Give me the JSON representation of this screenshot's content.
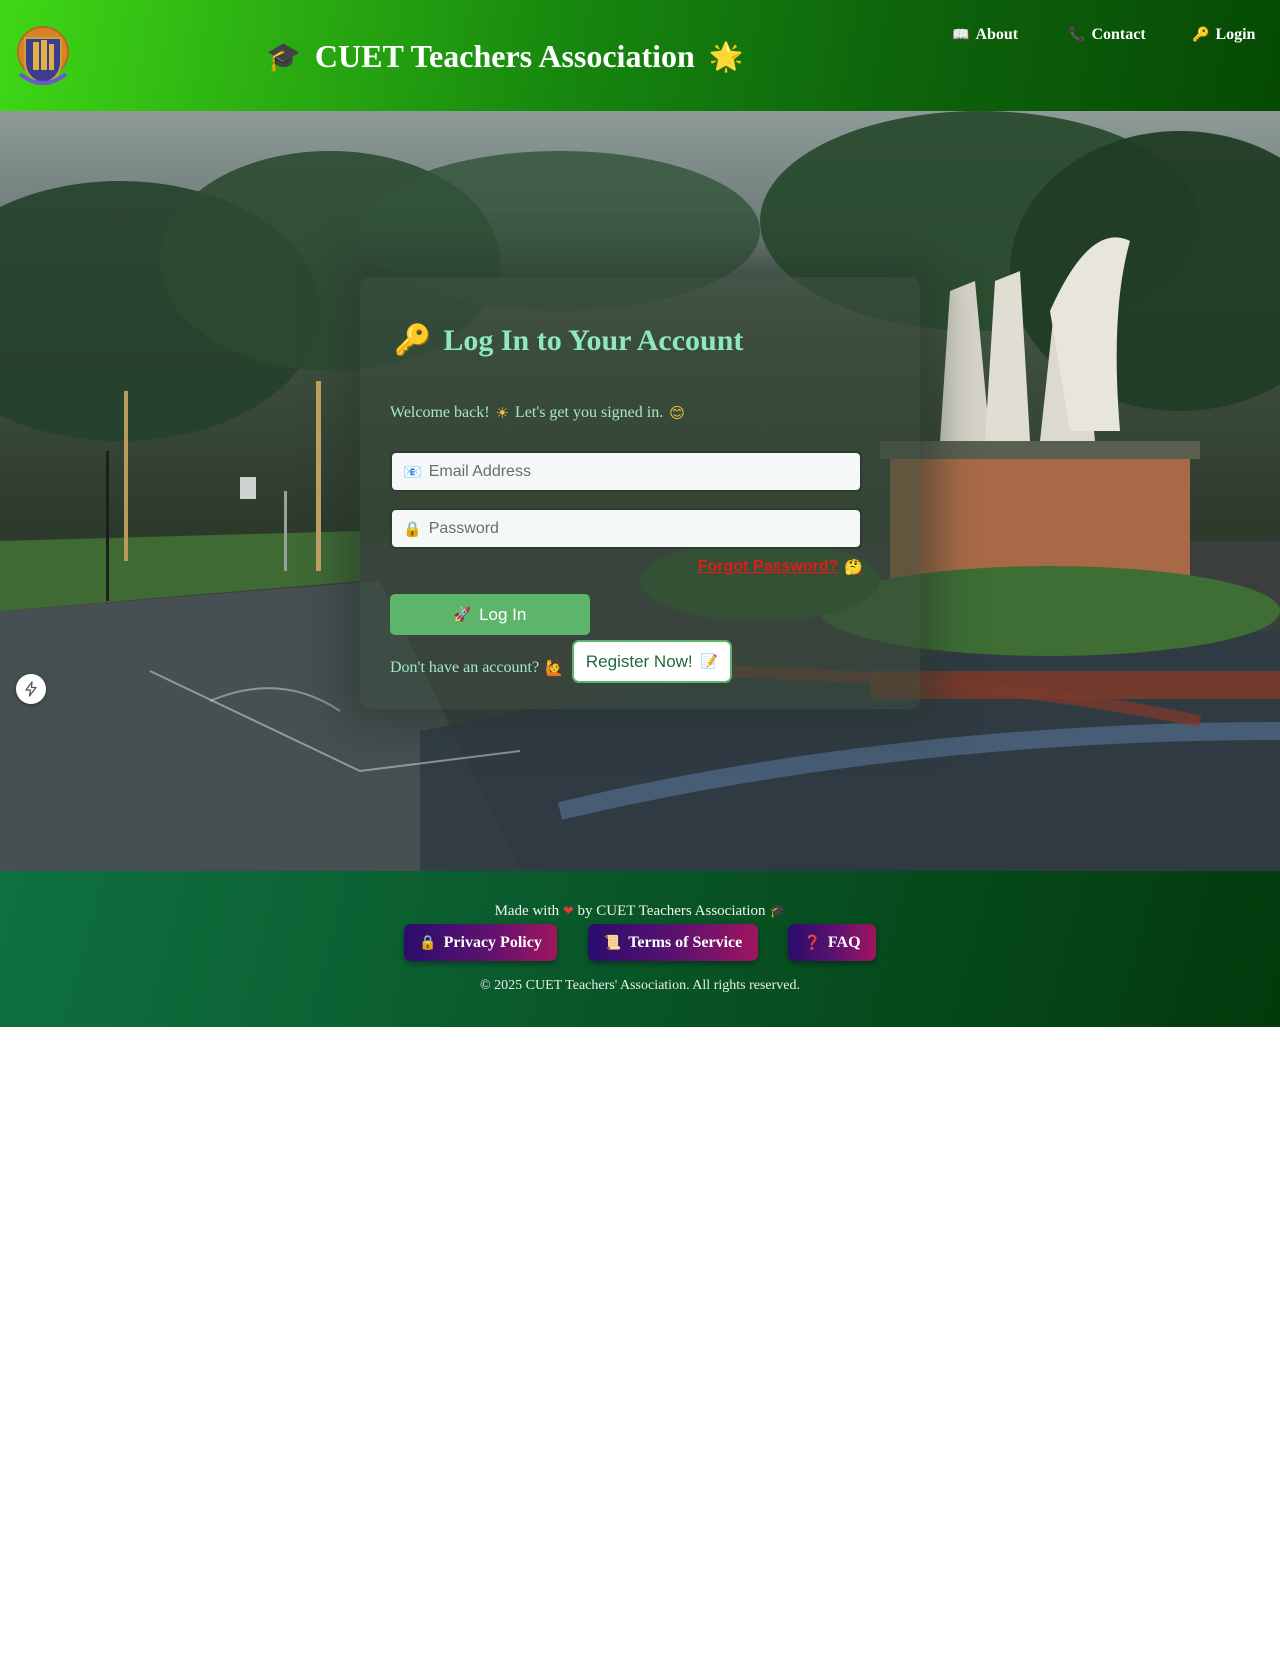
{
  "header": {
    "title": "CUET Teachers Association",
    "title_left_icon": "graduation-cap-icon",
    "title_right_icon": "sparkle-star-icon",
    "nav": [
      {
        "label": "About",
        "icon": "book-icon"
      },
      {
        "label": "Contact",
        "icon": "phone-icon"
      },
      {
        "label": "Login",
        "icon": "key-icon"
      }
    ]
  },
  "login": {
    "title": "Log In to Your Account",
    "title_icon": "key-icon",
    "welcome": "Welcome back!",
    "welcome_rest": "Let's get you signed in.",
    "email_placeholder": "Email Address",
    "password_placeholder": "Password",
    "forgot": "Forgot Password?",
    "login_button": "Log In",
    "no_account": "Don't have an account?",
    "register_button": "Register Now!"
  },
  "footer": {
    "made_with": "Made with",
    "made_by": "by CUET Teachers Association",
    "links": [
      {
        "label": "Privacy Policy",
        "icon": "lock-icon"
      },
      {
        "label": "Terms of Service",
        "icon": "scroll-icon"
      },
      {
        "label": "FAQ",
        "icon": "question-icon"
      }
    ],
    "copyright": "© 2025 CUET Teachers' Association. All rights reserved."
  },
  "colors": {
    "header_green": "#3fd816",
    "dark_green": "#064a04",
    "card_title": "#8fe8bd",
    "login_button": "#5cb56a",
    "forgot_link": "#e11a1a",
    "footer_button_start": "#2a0d6d",
    "footer_button_end": "#a0155f"
  }
}
